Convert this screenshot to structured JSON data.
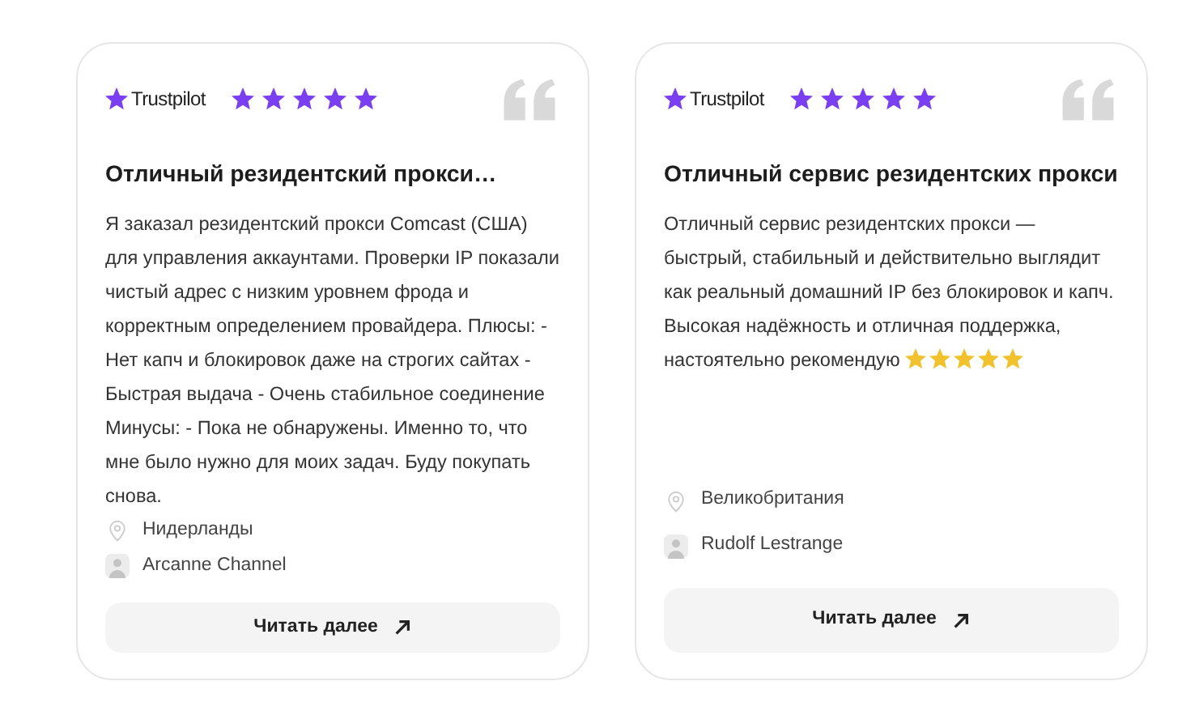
{
  "reviews": [
    {
      "source": "Trustpilot",
      "stars": 5,
      "title": "Отличный резидентский прокси…",
      "body": {
        "text": "Я заказал резидентский прокси Comcast (США) для управления аккаунтами. Проверки IP показали чистый адрес с низким уровнем фрода и корректным определением провайдера. Плюсы: - Нет капч и блокировок даже на строгих сайтах - Быстрая выдача - Очень стабильное соединение Минусы: - Пока не обнаружены. Именно то, что мне было нужно для моих задач. Буду покупать снова."
      },
      "location": "Нидерланды",
      "author": "Arcanne Channel",
      "button": "Читать далее"
    },
    {
      "source": "Trustpilot",
      "stars": 5,
      "title": "Отличный сервис резидентских прокси",
      "body": {
        "text": "Отличный сервис резидентских прокси — быстрый, стабильный и действительно выглядит как реальный домашний IP без блокировок и капч. Высокая надёжность и отличная поддержка, настоятельно рекомендую",
        "stars": 5
      },
      "location": "Великобритания",
      "author": "Rudolf Lestrange",
      "button": "Читать далее"
    }
  ]
}
